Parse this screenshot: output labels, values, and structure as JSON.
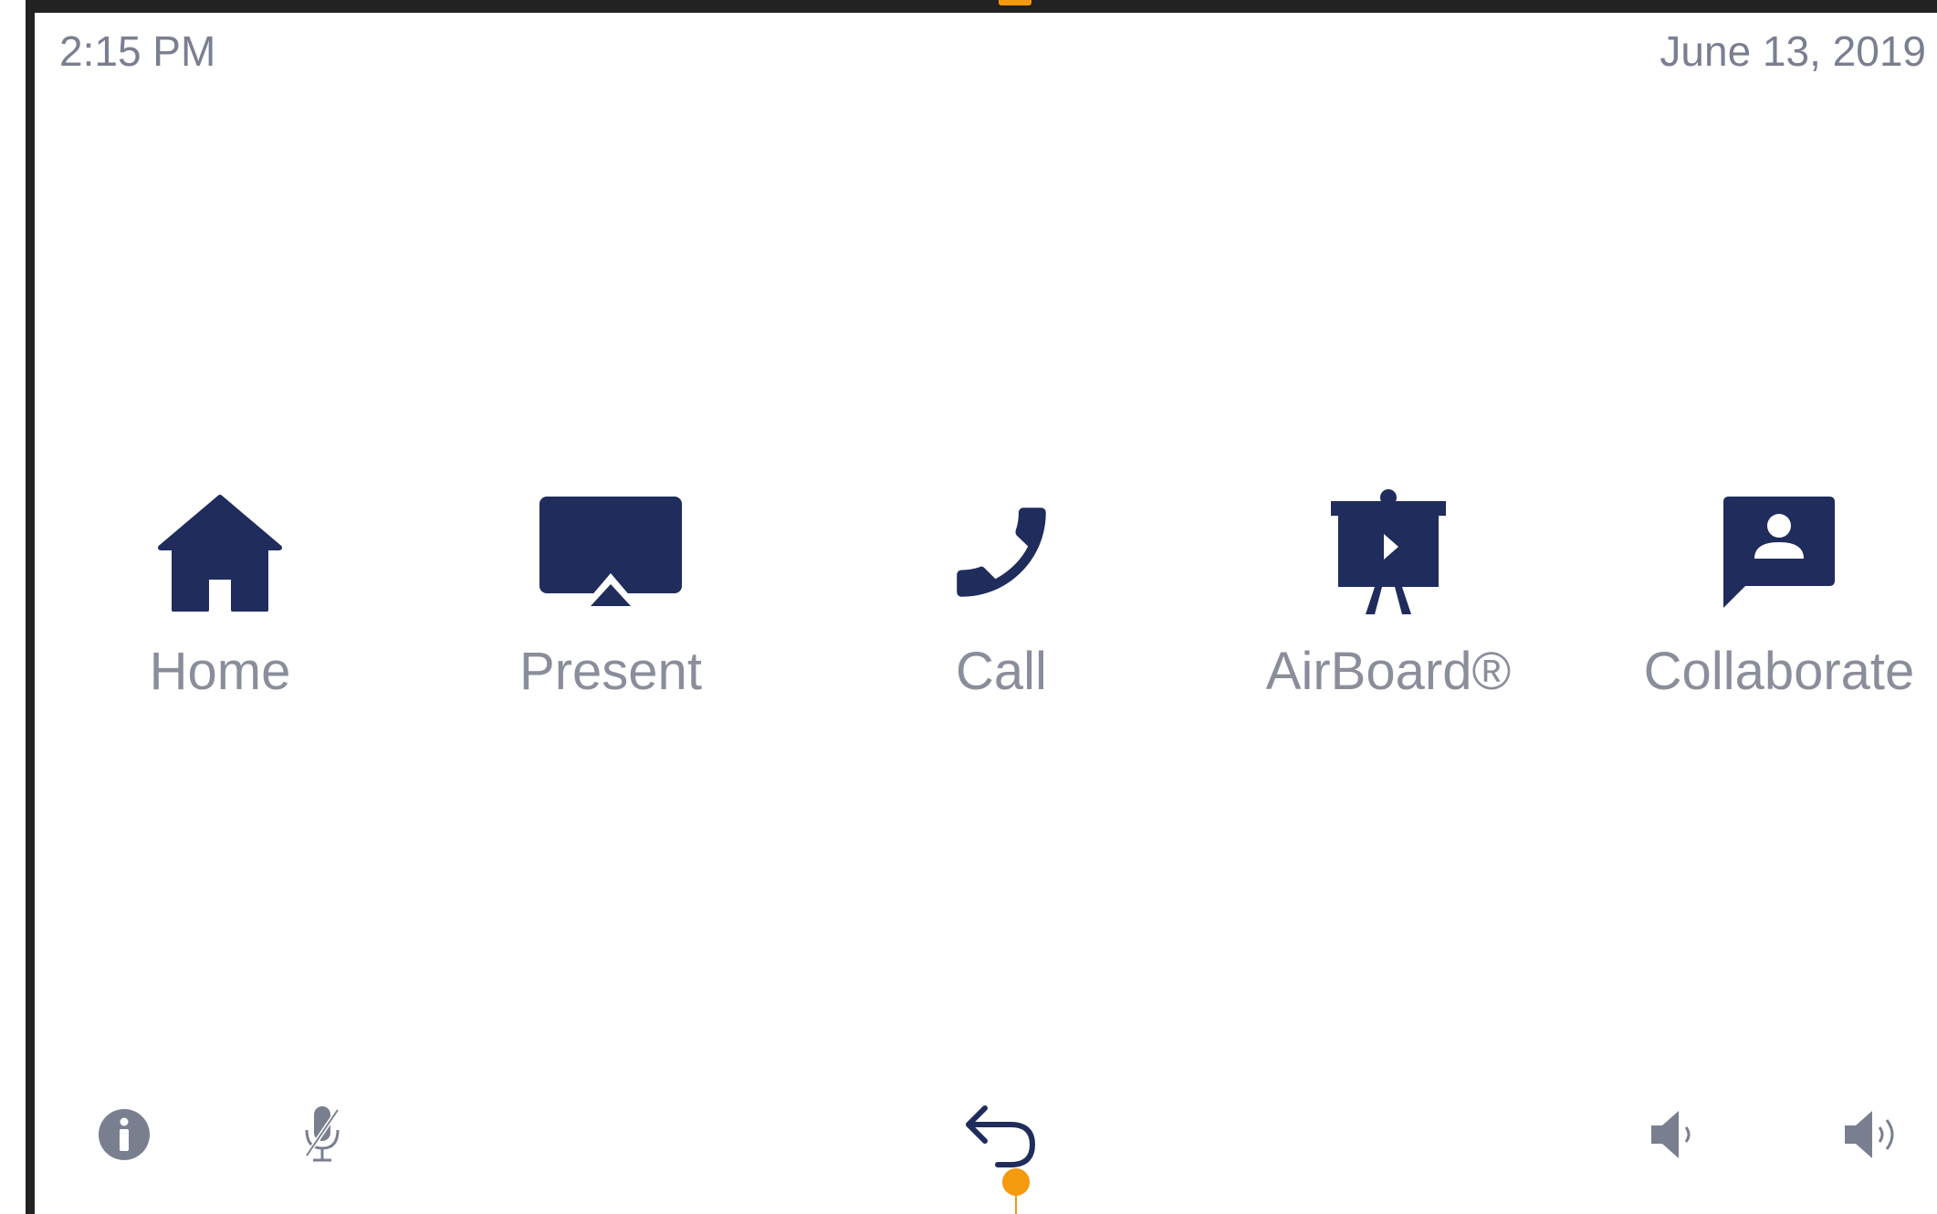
{
  "status": {
    "time": "2:15 PM",
    "date": "June 13, 2019"
  },
  "nav": [
    {
      "label": "Home",
      "icon": "home-icon"
    },
    {
      "label": "Present",
      "icon": "airplay-icon"
    },
    {
      "label": "Call",
      "icon": "phone-icon"
    },
    {
      "label": "AirBoard®",
      "icon": "presentation-board-icon"
    },
    {
      "label": "Collaborate",
      "icon": "chat-user-icon"
    }
  ],
  "bottom": [
    {
      "icon": "info-icon"
    },
    {
      "icon": "microphone-muted-icon"
    },
    {
      "icon": "back-arrow-icon"
    },
    {
      "icon": "volume-down-icon"
    },
    {
      "icon": "volume-up-icon"
    }
  ],
  "colors": {
    "icon": "#1f2c5c",
    "label": "#8a8e9b",
    "accent": "#f59a0c",
    "muted": "#7a7f90"
  }
}
